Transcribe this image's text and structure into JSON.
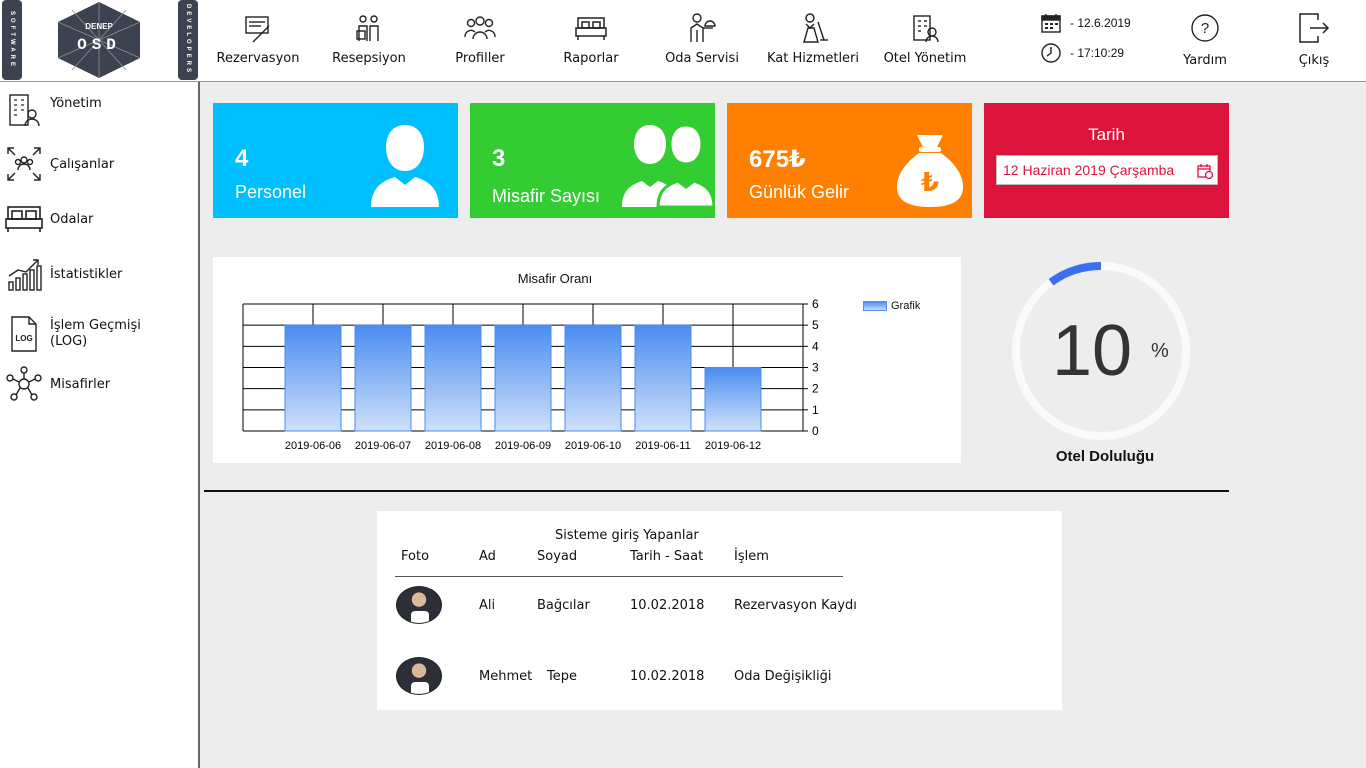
{
  "brand": {
    "left_strip": "SOFTWARE",
    "right_strip": "DEVELOPERS",
    "logo_top": "DENEP",
    "logo_main": "OSD"
  },
  "topnav": [
    {
      "label": "Rezervasyon",
      "icon": "reservation-icon"
    },
    {
      "label": "Resepsiyon",
      "icon": "reception-icon"
    },
    {
      "label": "Profiller",
      "icon": "profiles-icon"
    },
    {
      "label": "Raporlar",
      "icon": "bed-report-icon"
    },
    {
      "label": "Oda Servisi",
      "icon": "room-service-icon"
    },
    {
      "label": "Kat Hizmetleri",
      "icon": "housekeeping-icon"
    },
    {
      "label": "Otel Yönetim",
      "icon": "hotel-management-icon"
    }
  ],
  "datetime": {
    "date": "- 12.6.2019",
    "time": "- 17:10:29"
  },
  "help_label": "Yardım",
  "exit_label": "Çıkış",
  "sidebar": [
    {
      "label": "Yönetim",
      "icon": "building-icon"
    },
    {
      "label": "Çalışanlar",
      "icon": "employees-icon"
    },
    {
      "label": "Odalar",
      "icon": "bed-icon"
    },
    {
      "label": "İstatistikler",
      "icon": "statistics-icon"
    },
    {
      "label": "İşlem Geçmişi\n(LOG)",
      "icon": "log-icon"
    },
    {
      "label": "Misafirler",
      "icon": "guests-network-icon"
    }
  ],
  "cards": {
    "personel": {
      "value": "4",
      "label": "Personel",
      "color": "#00bfff"
    },
    "misafir": {
      "value": "3",
      "label": "Misafir Sayısı",
      "color": "#33cc33"
    },
    "gelir": {
      "value": "675₺",
      "label": "Günlük Gelir",
      "color": "#ff8000"
    },
    "tarih": {
      "title": "Tarih",
      "date_value": "12 Haziran 2019 Çarşamba",
      "color": "#dc143c"
    }
  },
  "chart_data": {
    "type": "bar",
    "title": "Misafir Oranı",
    "categories": [
      "2019-06-06",
      "2019-06-07",
      "2019-06-08",
      "2019-06-09",
      "2019-06-10",
      "2019-06-11",
      "2019-06-12"
    ],
    "series": [
      {
        "name": "Grafik",
        "values": [
          5,
          5,
          5,
          5,
          5,
          5,
          3
        ]
      }
    ],
    "ylim": [
      0,
      6
    ],
    "yticks": [
      "0",
      "1",
      "2",
      "3",
      "4",
      "5",
      "6"
    ],
    "grid": true,
    "legend": "top-right",
    "yaxis_side": "right"
  },
  "occupancy": {
    "value": "10",
    "unit": "%",
    "fraction": 0.1,
    "label": "Otel Doluluğu",
    "arc_color": "#3b6ff0"
  },
  "log": {
    "title": "Sisteme giriş Yapanlar",
    "headers": [
      "Foto",
      "Ad",
      "Soyad",
      "Tarih - Saat",
      "İşlem"
    ],
    "rows": [
      {
        "ad": "Ali",
        "soyad": "Bağcılar",
        "tarih": "10.02.2018",
        "islem": "Rezervasyon Kaydı"
      },
      {
        "ad": "Mehmet",
        "soyad": "Tepe",
        "tarih": "10.02.2018",
        "islem": "Oda Değişikliği"
      }
    ]
  }
}
